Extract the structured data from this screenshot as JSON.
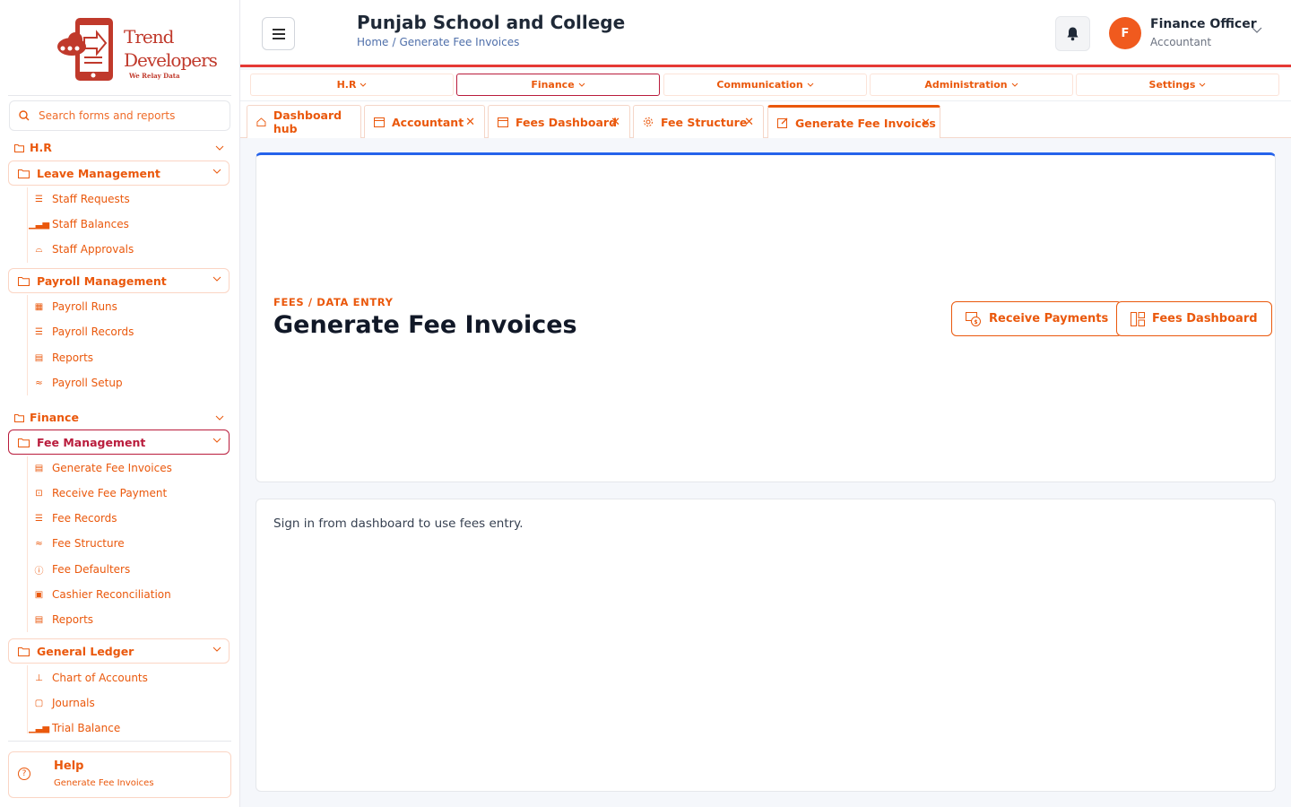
{
  "brand": {
    "line1": "Trend",
    "line2": "Developers",
    "tagline": "We Relay Data"
  },
  "search": {
    "placeholder": "Search forms and reports"
  },
  "sidebar": {
    "sections": [
      {
        "label": "H.R"
      },
      {
        "label": "Finance"
      }
    ],
    "groups": {
      "leave": {
        "label": "Leave Management",
        "items": [
          "Staff Requests",
          "Staff Balances",
          "Staff Approvals"
        ]
      },
      "payroll": {
        "label": "Payroll Management",
        "items": [
          "Payroll Runs",
          "Payroll Records",
          "Reports",
          "Payroll Setup"
        ]
      },
      "fee": {
        "label": "Fee Management",
        "items": [
          "Generate Fee Invoices",
          "Receive Fee Payment",
          "Fee Records",
          "Fee Structure",
          "Fee Defaulters",
          "Cashier Reconciliation",
          "Reports"
        ]
      },
      "ledger": {
        "label": "General Ledger",
        "items": [
          "Chart of Accounts",
          "Journals",
          "Trial Balance"
        ]
      }
    },
    "help": {
      "title": "Help",
      "subtitle": "Generate Fee Invoices"
    }
  },
  "header": {
    "title": "Punjab School and College",
    "breadcrumb": {
      "home": "Home",
      "separator": "/",
      "current": "Generate Fee Invoices"
    },
    "user": {
      "initial": "F",
      "name": "Finance Officer",
      "role": "Accountant"
    }
  },
  "modules": [
    "H.R",
    "Finance",
    "Communication",
    "Administration",
    "Settings"
  ],
  "active_module": "Finance",
  "tabs": [
    {
      "label": "Dashboard hub",
      "icon": "home-icon",
      "closable": false
    },
    {
      "label": "Accountant",
      "icon": "window-icon",
      "closable": true
    },
    {
      "label": "Fees Dashboard",
      "icon": "window-icon",
      "closable": true
    },
    {
      "label": "Fee Structure",
      "icon": "gear-icon",
      "closable": true
    },
    {
      "label": "Generate Fee Invoices",
      "icon": "edit-icon",
      "closable": true,
      "active": true
    }
  ],
  "page": {
    "eyebrow": "FEES / DATA ENTRY",
    "title": "Generate Fee Invoices",
    "actions": {
      "receive": "Receive Payments",
      "dashboard": "Fees Dashboard"
    },
    "message": "Sign in from dashboard to use fees entry."
  },
  "colors": {
    "accent": "#ea580c",
    "active_border": "#b91c3c",
    "header_rule": "#e53935",
    "card_top": "#2563eb",
    "avatar": "#f05a1e"
  }
}
